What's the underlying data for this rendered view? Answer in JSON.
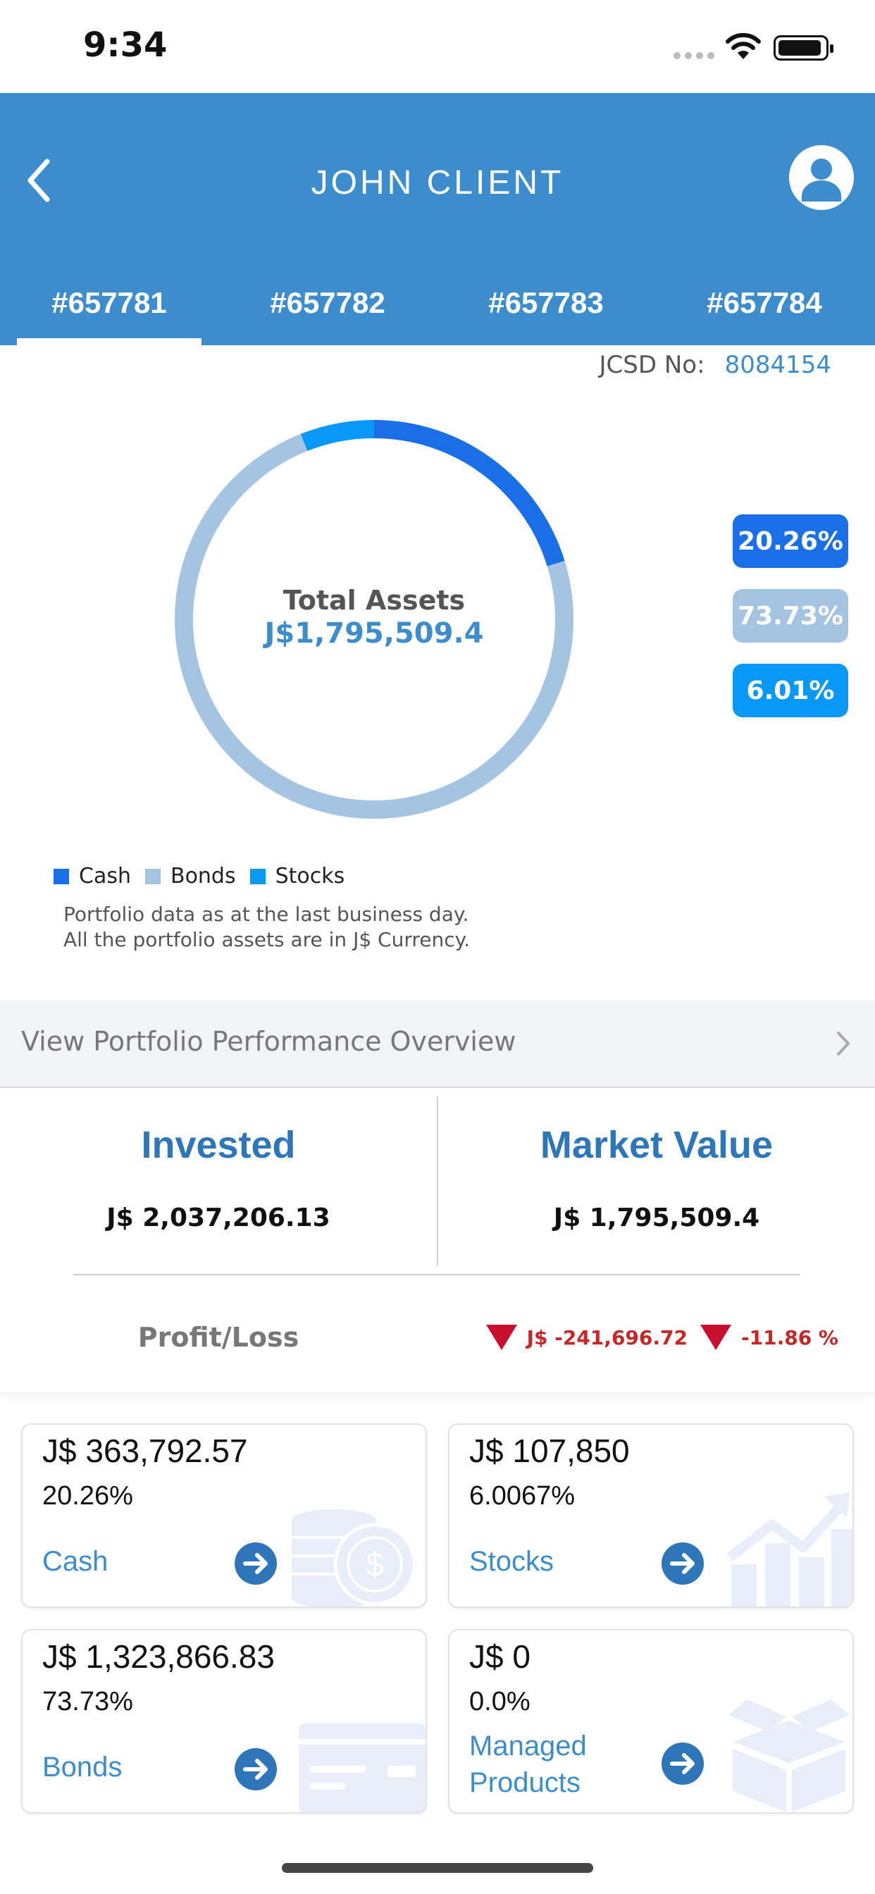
{
  "status_bar": {
    "time": "9:34"
  },
  "header": {
    "title": "JOHN CLIENT",
    "tabs": [
      {
        "label": "#657781",
        "active": true
      },
      {
        "label": "#657782",
        "active": false
      },
      {
        "label": "#657783",
        "active": false
      },
      {
        "label": "#657784",
        "active": false
      }
    ]
  },
  "jcsd": {
    "label": "JCSD No:",
    "number": "8084154"
  },
  "allocation": {
    "total_label": "Total Assets",
    "total_value": "J$1,795,509.4",
    "segments": [
      {
        "name": "Cash",
        "percent_label": "20.26%",
        "fraction": 0.2026,
        "color": "#1a6fe6"
      },
      {
        "name": "Bonds",
        "percent_label": "73.73%",
        "fraction": 0.7373,
        "color": "#a4c4e2"
      },
      {
        "name": "Stocks",
        "percent_label": "6.01%",
        "fraction": 0.0601,
        "color": "#0a98f6"
      }
    ],
    "note_line1": "Portfolio data as at the last business day.",
    "note_line2": "All the portfolio assets are in J$ Currency."
  },
  "performance_link": {
    "label": "View Portfolio Performance Overview"
  },
  "summary": {
    "invested_label": "Invested",
    "invested_value": "J$ 2,037,206.13",
    "market_label": "Market Value",
    "market_value": "J$ 1,795,509.4",
    "pl_label": "Profit/Loss",
    "pl_amount": "J$ -241,696.72",
    "pl_percent": "-11.86 %"
  },
  "cards": [
    {
      "amount": "J$ 363,792.57",
      "percent": "20.26%",
      "name": "Cash"
    },
    {
      "amount": "J$ 107,850",
      "percent": "6.0067%",
      "name": "Stocks"
    },
    {
      "amount": "J$ 1,323,866.83",
      "percent": "73.73%",
      "name": "Bonds"
    },
    {
      "amount": "J$ 0",
      "percent": "0.0%",
      "name_line1": "Managed",
      "name_line2": "Products"
    }
  ],
  "colors": {
    "header": "#3d8ccc",
    "accent": "#2e76b8",
    "loss": "#c62828"
  }
}
